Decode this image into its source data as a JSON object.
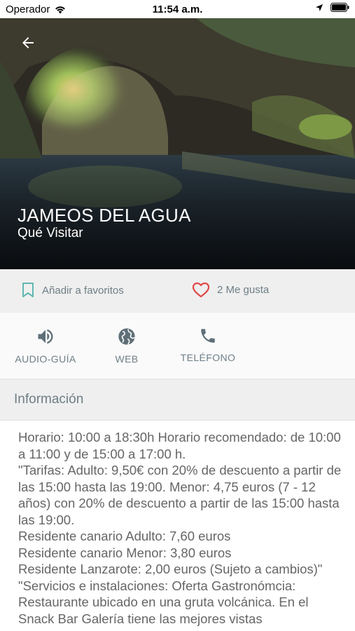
{
  "status_bar": {
    "carrier": "Operador",
    "time": "11:54 a.m."
  },
  "hero": {
    "title": "JAMEOS DEL AGUA",
    "subtitle": "Qué Visitar"
  },
  "actions": {
    "favorites_label": "Añadir a favoritos",
    "likes_label": "2 Me gusta"
  },
  "links": [
    {
      "label": "AUDIO-GUÍA",
      "icon": "speaker-icon"
    },
    {
      "label": "WEB",
      "icon": "globe-icon"
    },
    {
      "label": "TELÉFONO",
      "icon": "phone-icon"
    }
  ],
  "section": {
    "title": "Información"
  },
  "info_lines": [
    "Horario: 10:00 a 18:30h Horario recomendado: de 10:00 a 11:00 y de 15:00 a 17:00 h.",
    "\"Tarifas: Adulto: 9,50€ con 20% de descuento a partir de las 15:00 hasta las 19:00. Menor: 4,75 euros (7 - 12 años) con 20% de descuento a partir de las 15:00 hasta las 19:00.",
    "Residente canario Adulto: 7,60 euros",
    "Residente canario Menor: 3,80 euros",
    "Residente Lanzarote: 2,00 euros (Sujeto a cambios)\"",
    "\"Servicios e instalaciones: Oferta Gastronómcia: Restaurante ubicado en una gruta volcánica. En el Snack Bar Galería tiene las mejores vistas"
  ],
  "colors": {
    "accent_teal": "#5fb8b0",
    "like_red": "#e04848",
    "muted_text": "#6d7e86"
  }
}
